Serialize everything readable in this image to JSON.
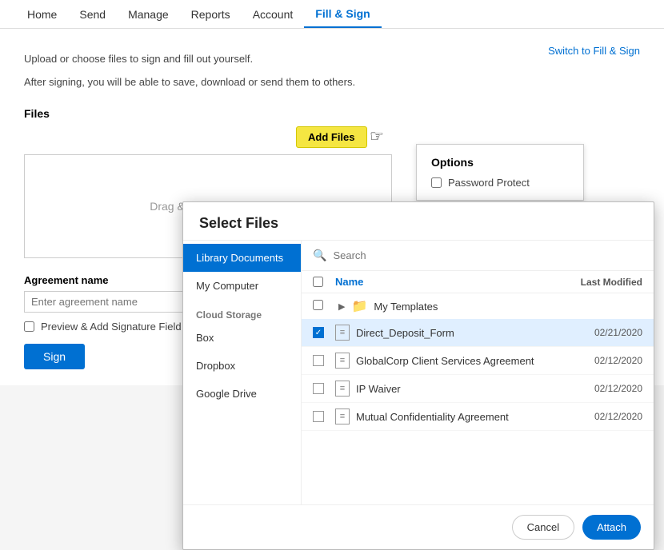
{
  "nav": {
    "items": [
      {
        "label": "Home",
        "active": false
      },
      {
        "label": "Send",
        "active": false
      },
      {
        "label": "Manage",
        "active": false
      },
      {
        "label": "Reports",
        "active": false
      },
      {
        "label": "Account",
        "active": false
      },
      {
        "label": "Fill & Sign",
        "active": true
      }
    ]
  },
  "main": {
    "switch_link": "Switch to Fill & Sign",
    "description_line1": "Upload or choose files to sign and fill out yourself.",
    "description_line2": "After signing, you will be able to save, download or send them to others.",
    "files_label": "Files",
    "add_files_btn": "Add Files",
    "drop_zone_text": "Drag & Drop Files Here",
    "options_title": "Options",
    "password_protect_label": "Password Protect",
    "agreement_label": "Agreement name",
    "agreement_placeholder": "Enter agreement name",
    "preview_label": "Preview & Add Signature Field",
    "sign_btn": "Sign"
  },
  "modal": {
    "title": "Select Files",
    "search_placeholder": "Search",
    "sidebar": {
      "items": [
        {
          "label": "Library Documents",
          "active": true
        },
        {
          "label": "My Computer",
          "active": false
        }
      ],
      "cloud_group": "Cloud Storage",
      "cloud_items": [
        {
          "label": "Box",
          "active": false
        },
        {
          "label": "Dropbox",
          "active": false
        },
        {
          "label": "Google Drive",
          "active": false
        }
      ]
    },
    "table": {
      "col_name": "Name",
      "col_modified": "Last Modified",
      "folder_row": {
        "arrow": "▶",
        "name": "My Templates"
      },
      "rows": [
        {
          "name": "Direct_Deposit_Form",
          "modified": "02/21/2020",
          "checked": true
        },
        {
          "name": "GlobalCorp Client Services Agreement",
          "modified": "02/12/2020",
          "checked": false
        },
        {
          "name": "IP Waiver",
          "modified": "02/12/2020",
          "checked": false
        },
        {
          "name": "Mutual Confidentiality Agreement",
          "modified": "02/12/2020",
          "checked": false
        }
      ]
    },
    "cancel_btn": "Cancel",
    "attach_btn": "Attach"
  }
}
